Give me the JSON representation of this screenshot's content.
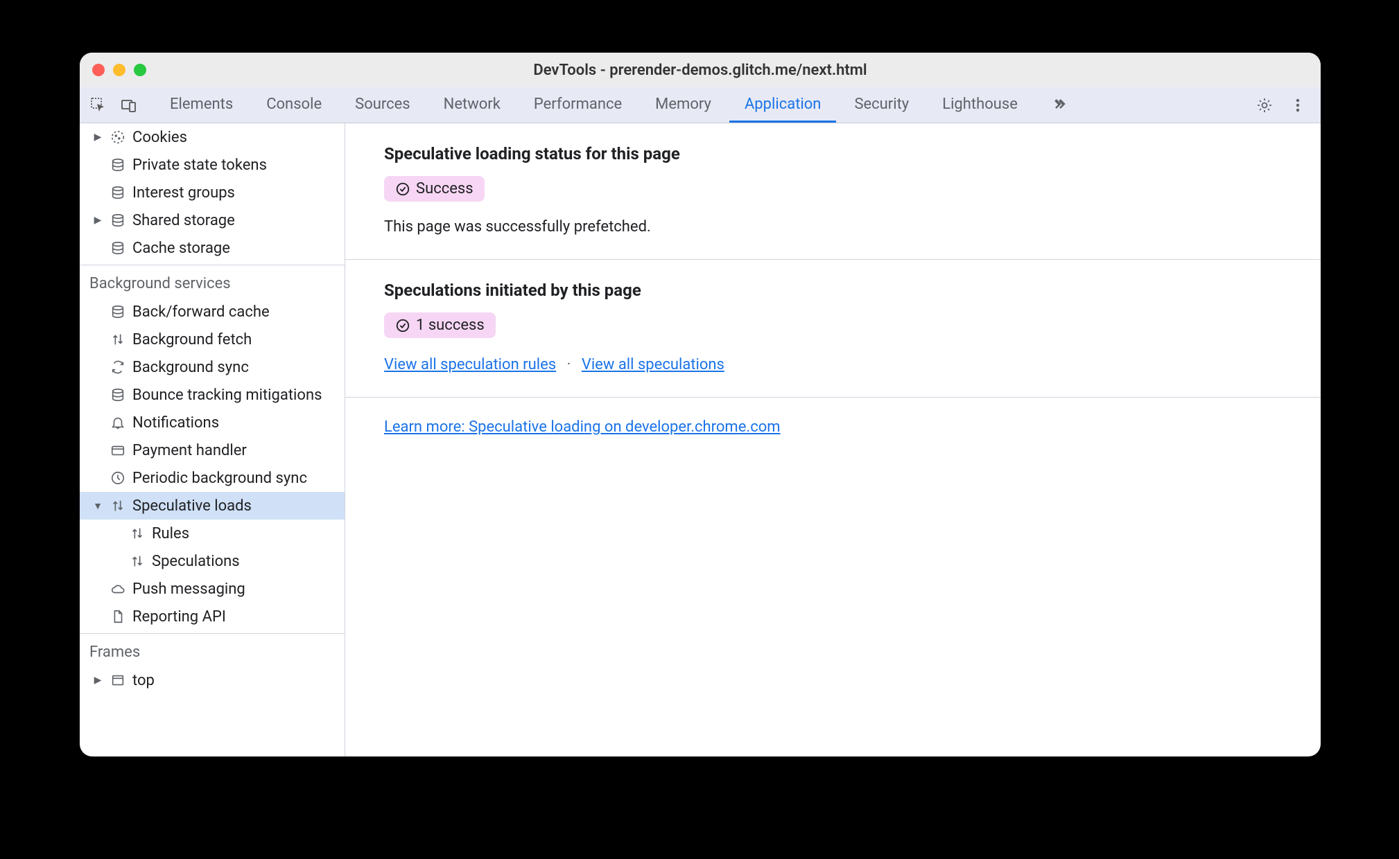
{
  "window": {
    "title": "DevTools - prerender-demos.glitch.me/next.html"
  },
  "tabs": [
    "Elements",
    "Console",
    "Sources",
    "Network",
    "Performance",
    "Memory",
    "Application",
    "Security",
    "Lighthouse"
  ],
  "active_tab": "Application",
  "sidebar": {
    "storage_items": [
      {
        "label": "Cookies",
        "icon": "cookie",
        "expandable": true
      },
      {
        "label": "Private state tokens",
        "icon": "db",
        "expandable": false
      },
      {
        "label": "Interest groups",
        "icon": "db",
        "expandable": false
      },
      {
        "label": "Shared storage",
        "icon": "db",
        "expandable": true
      },
      {
        "label": "Cache storage",
        "icon": "db",
        "expandable": false
      }
    ],
    "bg_header": "Background services",
    "bg_items": [
      {
        "label": "Back/forward cache",
        "icon": "db"
      },
      {
        "label": "Background fetch",
        "icon": "arrows"
      },
      {
        "label": "Background sync",
        "icon": "sync"
      },
      {
        "label": "Bounce tracking mitigations",
        "icon": "db"
      },
      {
        "label": "Notifications",
        "icon": "bell"
      },
      {
        "label": "Payment handler",
        "icon": "card"
      },
      {
        "label": "Periodic background sync",
        "icon": "clock"
      },
      {
        "label": "Speculative loads",
        "icon": "arrows",
        "expanded": true,
        "selected": true,
        "children": [
          {
            "label": "Rules",
            "icon": "arrows"
          },
          {
            "label": "Speculations",
            "icon": "arrows"
          }
        ]
      },
      {
        "label": "Push messaging",
        "icon": "cloud"
      },
      {
        "label": "Reporting API",
        "icon": "file"
      }
    ],
    "frames_header": "Frames",
    "frames_items": [
      {
        "label": "top",
        "icon": "frame",
        "expandable": true
      }
    ]
  },
  "main": {
    "section1_title": "Speculative loading status for this page",
    "badge1_text": "Success",
    "section1_body": "This page was successfully prefetched.",
    "section2_title": "Speculations initiated by this page",
    "badge2_text": "1 success",
    "link_rules": "View all speculation rules",
    "link_specs": "View all speculations",
    "separator": "·",
    "learn_more": "Learn more: Speculative loading on developer.chrome.com"
  }
}
